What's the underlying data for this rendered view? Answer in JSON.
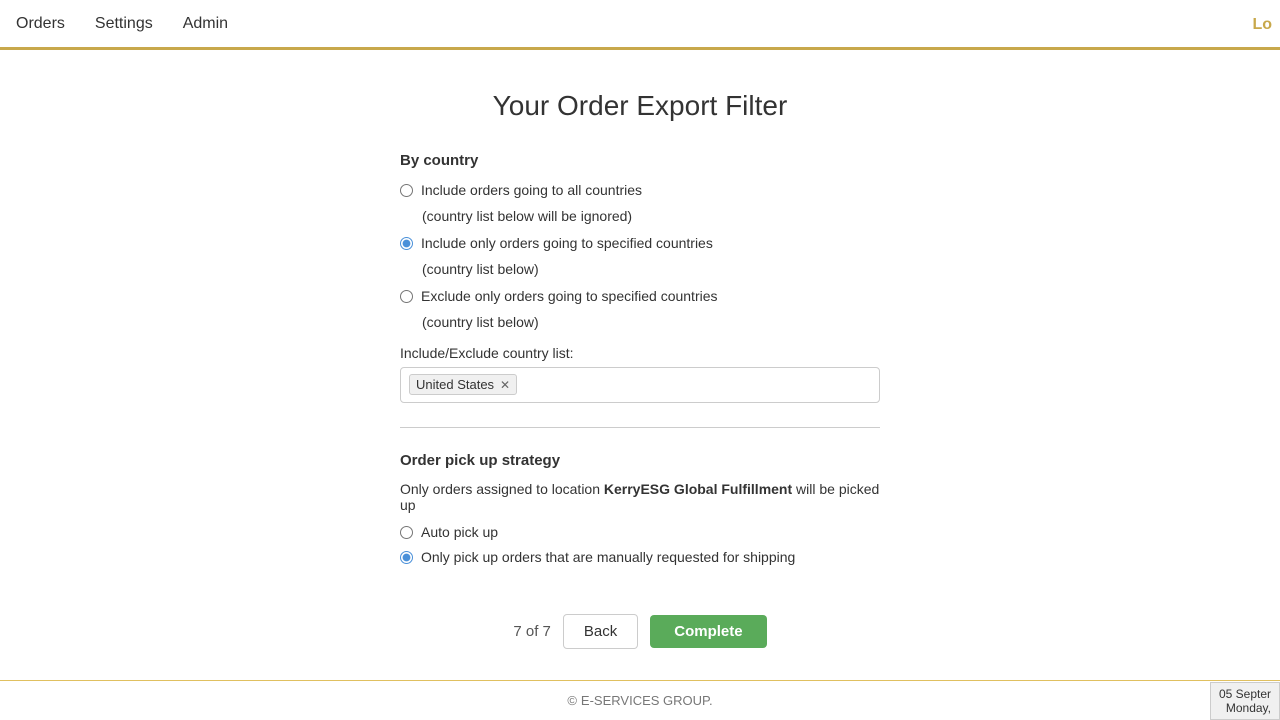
{
  "header": {
    "nav": [
      {
        "label": "Orders",
        "id": "orders"
      },
      {
        "label": "Settings",
        "id": "settings"
      },
      {
        "label": "Admin",
        "id": "admin"
      }
    ],
    "right_label": "Lo"
  },
  "page": {
    "title": "Your Order Export Filter"
  },
  "by_country": {
    "section_title": "By country",
    "options": [
      {
        "id": "all_countries",
        "label": "Include orders going to all countries",
        "sub": "(country list below will be ignored)",
        "checked": false
      },
      {
        "id": "specified_include",
        "label": "Include only orders going to specified countries",
        "sub": "(country list below)",
        "checked": true
      },
      {
        "id": "specified_exclude",
        "label": "Exclude only orders going to specified countries",
        "sub": "(country list below)",
        "checked": false
      }
    ],
    "country_list_label": "Include/Exclude country list:",
    "country_tags": [
      {
        "name": "United States"
      }
    ]
  },
  "order_pickup": {
    "section_title": "Order pick up strategy",
    "description_prefix": "Only orders assigned to location ",
    "location_name": "KerryESG Global Fulfillment",
    "description_suffix": " will be picked up",
    "options": [
      {
        "id": "auto_pickup",
        "label": "Auto pick up",
        "checked": false
      },
      {
        "id": "manual_pickup",
        "label": "Only pick up orders that are manually requested for shipping",
        "checked": true
      }
    ]
  },
  "navigation": {
    "page_indicator": "7 of 7",
    "back_label": "Back",
    "complete_label": "Complete"
  },
  "footer": {
    "icon": "©",
    "text": "E-SERVICES GROUP."
  },
  "date_widget": {
    "line1": "05 Septer",
    "line2": "Monday,"
  }
}
